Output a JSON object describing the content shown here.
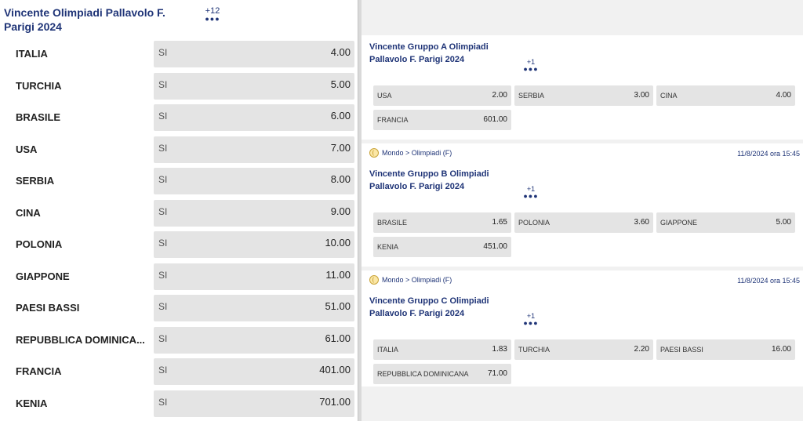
{
  "main_market": {
    "title": "Vincente Olimpiadi Pallavolo F. Parigi 2024",
    "more_count": "+12",
    "selection_label": "SI",
    "teams": [
      {
        "name": "ITALIA",
        "odd": "4.00"
      },
      {
        "name": "TURCHIA",
        "odd": "5.00"
      },
      {
        "name": "BRASILE",
        "odd": "6.00"
      },
      {
        "name": "USA",
        "odd": "7.00"
      },
      {
        "name": "SERBIA",
        "odd": "8.00"
      },
      {
        "name": "CINA",
        "odd": "9.00"
      },
      {
        "name": "POLONIA",
        "odd": "10.00"
      },
      {
        "name": "GIAPPONE",
        "odd": "11.00"
      },
      {
        "name": "PAESI BASSI",
        "odd": "51.00"
      },
      {
        "name": "REPUBBLICA DOMINICA...",
        "odd": "61.00"
      },
      {
        "name": "FRANCIA",
        "odd": "401.00"
      },
      {
        "name": "KENIA",
        "odd": "701.00"
      }
    ]
  },
  "groups": [
    {
      "breadcrumb": "",
      "date": "",
      "title": "Vincente Gruppo A Olimpiadi Pallavolo F. Parigi 2024",
      "more_count": "+1",
      "options": [
        {
          "label": "USA",
          "odd": "2.00"
        },
        {
          "label": "SERBIA",
          "odd": "3.00"
        },
        {
          "label": "CINA",
          "odd": "4.00"
        },
        {
          "label": "FRANCIA",
          "odd": "601.00"
        }
      ]
    },
    {
      "breadcrumb": "Mondo > Olimpiadi (F)",
      "date": "11/8/2024 ora 15:45",
      "title": "Vincente Gruppo B Olimpiadi Pallavolo F. Parigi 2024",
      "more_count": "+1",
      "options": [
        {
          "label": "BRASILE",
          "odd": "1.65"
        },
        {
          "label": "POLONIA",
          "odd": "3.60"
        },
        {
          "label": "GIAPPONE",
          "odd": "5.00"
        },
        {
          "label": "KENIA",
          "odd": "451.00"
        }
      ]
    },
    {
      "breadcrumb": "Mondo > Olimpiadi (F)",
      "date": "11/8/2024 ora 15:45",
      "title": "Vincente Gruppo C Olimpiadi Pallavolo F. Parigi 2024",
      "more_count": "+1",
      "options": [
        {
          "label": "ITALIA",
          "odd": "1.83"
        },
        {
          "label": "TURCHIA",
          "odd": "2.20"
        },
        {
          "label": "PAESI BASSI",
          "odd": "16.00"
        },
        {
          "label": "REPUBBLICA DOMINICANA",
          "odd": "71.00"
        }
      ]
    }
  ],
  "colors": {
    "title": "#1f3477",
    "cell_bg": "#e4e4e4",
    "panel_bg": "#f1f1f1"
  }
}
